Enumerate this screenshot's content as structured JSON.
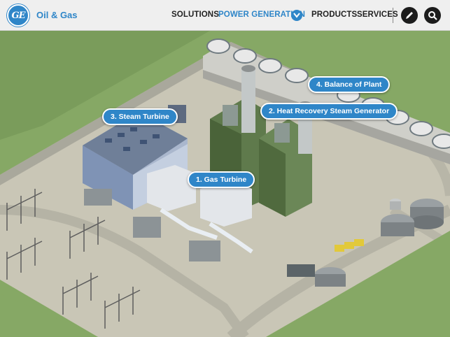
{
  "header": {
    "logo_text": "GE",
    "brand": "Oil & Gas",
    "nav": [
      {
        "label": "SOLUTIONS"
      },
      {
        "label": "POWER GENERATION"
      },
      {
        "label": "PRODUCTS"
      },
      {
        "label": "SERVICES"
      }
    ],
    "icons": [
      "chevron-down-icon",
      "pencil-icon",
      "search-icon"
    ],
    "accent_color": "#2f86c8"
  },
  "hotspots": [
    {
      "label": "1.  Gas Turbine"
    },
    {
      "label": "2.  Heat Recovery Steam Generator"
    },
    {
      "label": "3.  Steam Turbine"
    },
    {
      "label": "4.  Balance of Plant"
    }
  ]
}
